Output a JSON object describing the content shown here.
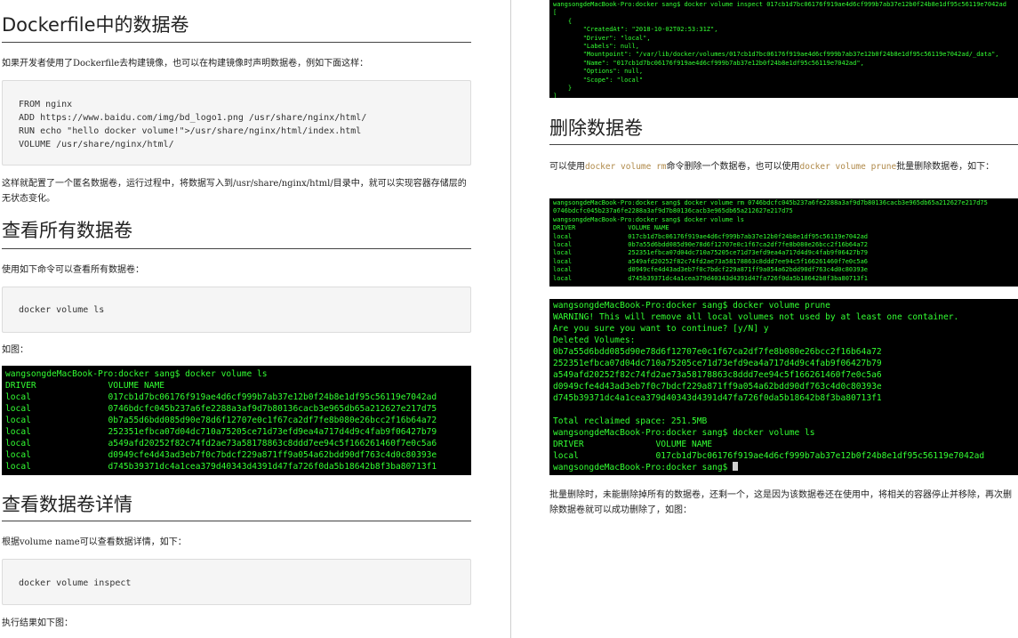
{
  "left": {
    "h_dockerfile": "Dockerfile中的数据卷",
    "p_dockerfile": "如果开发者使用了Dockerfile去构建镜像，也可以在构建镜像时声明数据卷，例如下面这样：",
    "code_dockerfile": "FROM nginx\nADD https://www.baidu.com/img/bd_logo1.png /usr/share/nginx/html/\nRUN echo \"hello docker volume!\">/usr/share/nginx/html/index.html\nVOLUME /usr/share/nginx/html/",
    "p_anon": "这样就配置了一个匿名数据卷，运行过程中，将数据写入到/usr/share/nginx/html/目录中，就可以实现容器存储层的无状态变化。",
    "h_list": "查看所有数据卷",
    "p_list": "使用如下命令可以查看所有数据卷：",
    "code_list": "docker volume ls",
    "p_figure": "如图：",
    "term_ls": "wangsongdeMacBook-Pro:docker sang$ docker volume ls\nDRIVER              VOLUME NAME\nlocal               017cb1d7bc06176f919ae4d6cf999b7ab37e12b0f24b8e1df95c56119e7042ad\nlocal               0746bdcfc045b237a6fe2288a3af9d7b80136cacb3e965db65a212627e217d75\nlocal               0b7a55d6bdd085d90e78d6f12707e0c1f67ca2df7fe8b080e26bcc2f16b64a72\nlocal               252351efbca07d04dc710a75205ce71d73efd9ea4a717d4d9c4fab9f06427b79\nlocal               a549afd20252f82c74fd2ae73a58178863c8ddd7ee94c5f166261460f7e0c5a6\nlocal               d0949cfe4d43ad3eb7f0c7bdcf229a871ff9a054a62bdd90df763c4d0c80393e\nlocal               d745b39371dc4a1cea379d40343d4391d47fa726f0da5b18642b8f3ba80713f1",
    "h_inspect": "查看数据卷详情",
    "p_inspect": "根据volume name可以查看数据详情，如下：",
    "code_inspect": "docker volume inspect",
    "p_result": "执行结果如下图："
  },
  "right": {
    "term_inspect": "wangsongdeMacBook-Pro:docker sang$ docker volume inspect 017cb1d7bc06176f919ae4d6cf999b7ab37e12b0f24b8e1df95c56119e7042ad\n[\n    {\n        \"CreatedAt\": \"2018-10-02T02:53:31Z\",\n        \"Driver\": \"local\",\n        \"Labels\": null,\n        \"Mountpoint\": \"/var/lib/docker/volumes/017cb1d7bc06176f919ae4d6cf999b7ab37e12b0f24b8e1df95c56119e7042ad/_data\",\n        \"Name\": \"017cb1d7bc06176f919ae4d6cf999b7ab37e12b0f24b8e1df95c56119e7042ad\",\n        \"Options\": null,\n        \"Scope\": \"local\"\n    }\n]",
    "h_delete": "删除数据卷",
    "p_delete_1": "可以使用",
    "cmd_rm": "docker volume rm",
    "p_delete_2": "命令删除一个数据卷，也可以使用",
    "cmd_prune": "docker volume prune",
    "p_delete_3": "批量删除数据卷，如下：",
    "term_rm": "wangsongdeMacBook-Pro:docker sang$ docker volume rm 0746bdcfc045b237a6fe2288a3af9d7b80136cacb3e965db65a212627e217d75\n0746bdcfc045b237a6fe2288a3af9d7b80136cacb3e965db65a212627e217d75\nwangsongdeMacBook-Pro:docker sang$ docker volume ls\nDRIVER              VOLUME NAME\nlocal               017cb1d7bc06176f919ae4d6cf999b7ab37e12b0f24b8e1df95c56119e7042ad\nlocal               0b7a55d6bdd085d90e78d6f12707e0c1f67ca2df7fe8b080e26bcc2f16b64a72\nlocal               252351efbca07d04dc710a75205ce71d73efd9ea4a717d4d9c4fab9f06427b79\nlocal               a549afd20252f82c74fd2ae73a58178863c8ddd7ee94c5f166261460f7e0c5a6\nlocal               d0949cfe4d43ad3eb7f0c7bdcf229a871ff9a054a62bdd90df763c4d0c80393e\nlocal               d745b39371dc4a1cea379d40343d4391d47fa726f0da5b18642b8f3ba80713f1",
    "term_prune": "wangsongdeMacBook-Pro:docker sang$ docker volume prune\nWARNING! This will remove all local volumes not used by at least one container.\nAre you sure you want to continue? [y/N] y\nDeleted Volumes:\n0b7a55d6bdd085d90e78d6f12707e0c1f67ca2df7fe8b080e26bcc2f16b64a72\n252351efbca07d04dc710a75205ce71d73efd9ea4a717d4d9c4fab9f06427b79\na549afd20252f82c74fd2ae73a58178863c8ddd7ee94c5f166261460f7e0c5a6\nd0949cfe4d43ad3eb7f0c7bdcf229a871ff9a054a62bdd90df763c4d0c80393e\nd745b39371dc4a1cea379d40343d4391d47fa726f0da5b18642b8f3ba80713f1\n\nTotal reclaimed space: 251.5MB\nwangsongdeMacBook-Pro:docker sang$ docker volume ls\nDRIVER              VOLUME NAME\nlocal               017cb1d7bc06176f919ae4d6cf999b7ab37e12b0f24b8e1df95c56119e7042ad\nwangsongdeMacBook-Pro:docker sang$ ",
    "p_after": "批量删除时，未能删除掉所有的数据卷，还剩一个，这是因为该数据卷还在使用中，将相关的容器停止并移除，再次删除数据卷就可以成功删除了，如图："
  },
  "colors": {
    "terminal_bg": "#000000",
    "terminal_text": "#33ff33",
    "inline_code": "#b08a4a",
    "code_bg": "#f5f5f5"
  }
}
